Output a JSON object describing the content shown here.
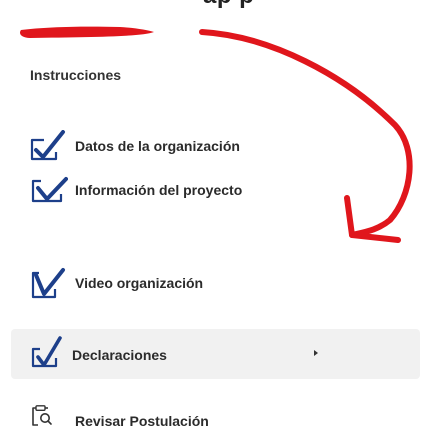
{
  "header": {
    "partial_title": "ap    p"
  },
  "sidebar": {
    "section_title": "Instrucciones",
    "items": [
      {
        "label": "Datos de la organización",
        "icon": "check-box-icon",
        "state": "completed"
      },
      {
        "label": "Información del proyecto",
        "icon": "check-box-icon",
        "state": "completed"
      },
      {
        "label": "Video organización",
        "icon": "check-box-icon",
        "state": "completed"
      },
      {
        "label": "Declaraciones",
        "icon": "check-box-icon",
        "state": "active"
      },
      {
        "label": "Revisar Postulación",
        "icon": "clipboard-search-icon",
        "state": "pending"
      }
    ]
  },
  "colors": {
    "icon_blue": "#1d3f8a",
    "annotation_red": "#e0161c",
    "active_background": "#f1f1f1",
    "text": "#2b2b2b"
  }
}
